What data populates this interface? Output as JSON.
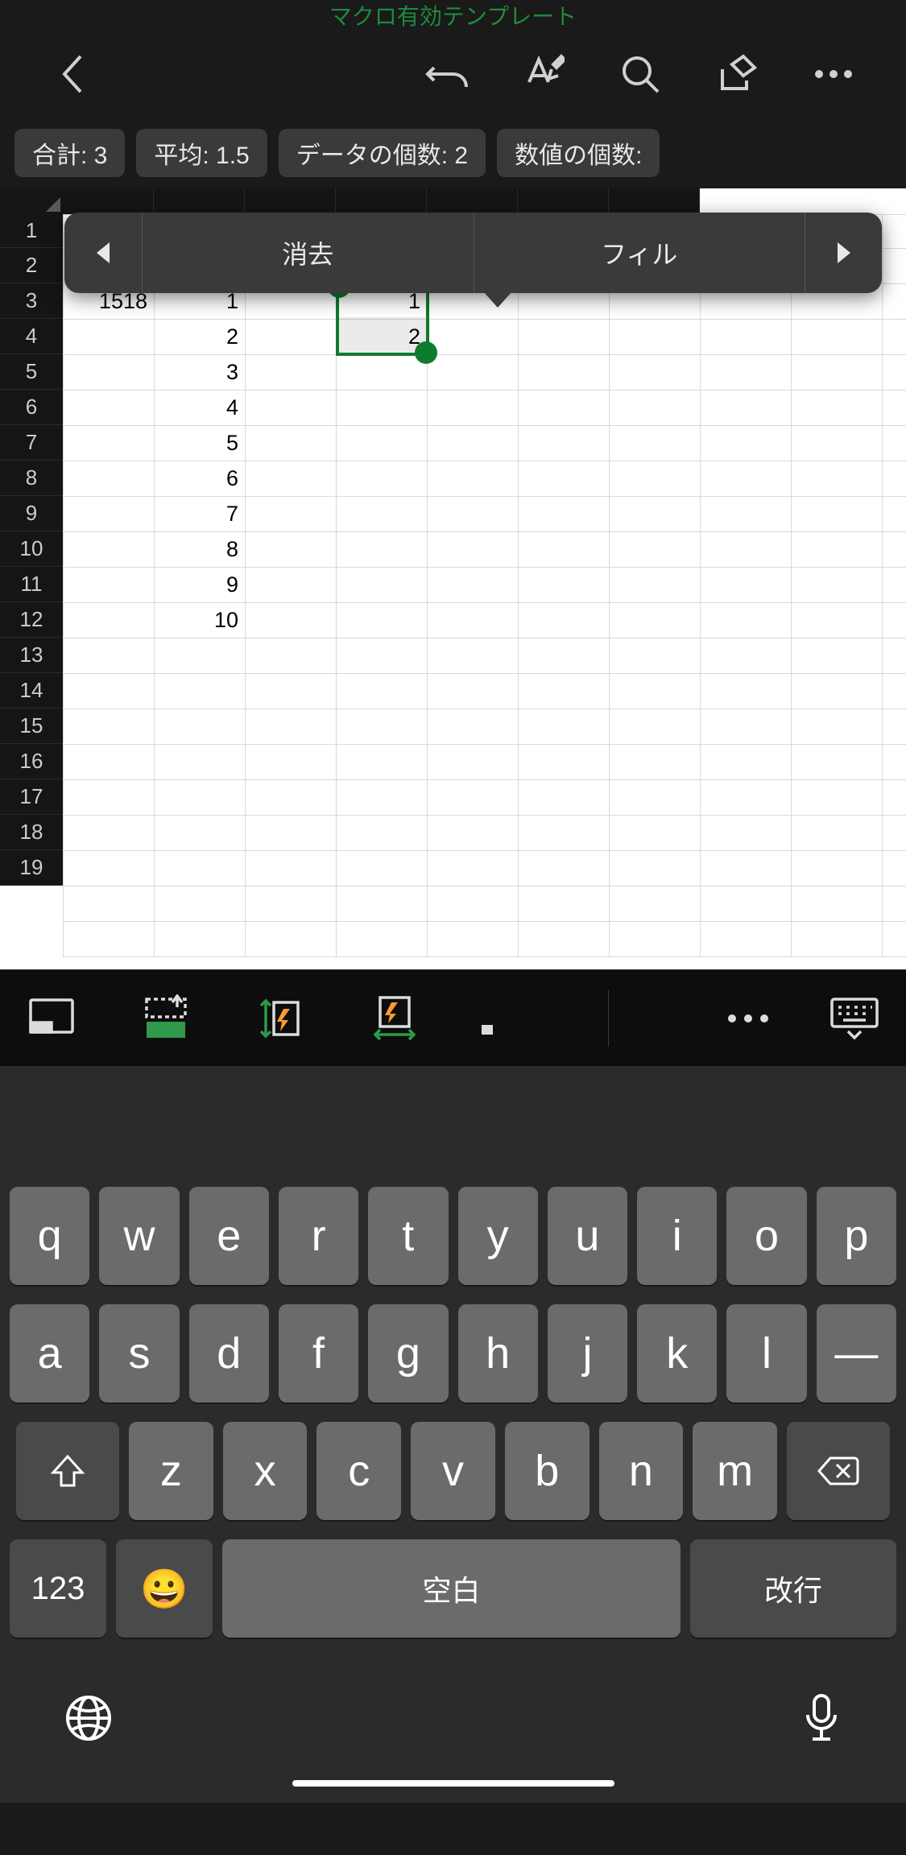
{
  "title": "マクロ有効テンプレート",
  "stats": {
    "sum": "合計: 3",
    "avg": "平均: 1.5",
    "count": "データの個数: 2",
    "ncount": "数値の個数:"
  },
  "context_menu": {
    "clear": "消去",
    "fill": "フィル"
  },
  "rows": [
    "1",
    "2",
    "3",
    "4",
    "5",
    "6",
    "7",
    "8",
    "9",
    "10",
    "11",
    "12",
    "13",
    "14",
    "15",
    "16",
    "17",
    "18",
    "19"
  ],
  "cells": {
    "A3": "1518",
    "B3": "1",
    "B4": "2",
    "B5": "3",
    "B6": "4",
    "B7": "5",
    "B8": "6",
    "B9": "7",
    "B10": "8",
    "B11": "9",
    "B12": "10",
    "D3": "1",
    "D4": "2"
  },
  "selection": {
    "range": "D3:D4",
    "values": [
      1,
      2
    ]
  },
  "keyboard": {
    "row1": [
      "q",
      "w",
      "e",
      "r",
      "t",
      "y",
      "u",
      "i",
      "o",
      "p"
    ],
    "row2": [
      "a",
      "s",
      "d",
      "f",
      "g",
      "h",
      "j",
      "k",
      "l",
      "—"
    ],
    "row3": [
      "z",
      "x",
      "c",
      "v",
      "b",
      "n",
      "m"
    ],
    "num": "123",
    "space": "空白",
    "enter": "改行"
  },
  "icons": {
    "back": "back-icon",
    "undo": "undo-icon",
    "format": "format-icon",
    "search": "search-icon",
    "share": "share-icon",
    "more": "more-icon",
    "emoji": "😀",
    "globe": "globe-icon",
    "mic": "mic-icon"
  }
}
